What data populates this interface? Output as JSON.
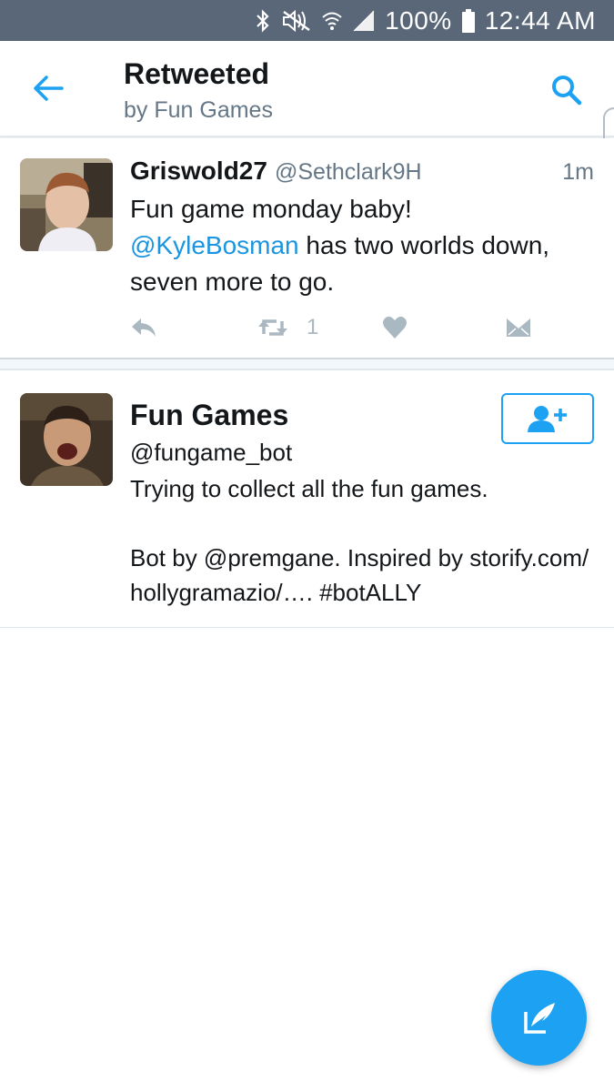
{
  "status_bar": {
    "icons": [
      "bluetooth-icon",
      "mute-icon",
      "wifi-icon",
      "signal-icon",
      "battery-icon"
    ],
    "battery": "100%",
    "time": "12:44 AM",
    "background": "#596778"
  },
  "header": {
    "title": "Retweeted",
    "subtitle": "by Fun Games",
    "back_icon": "back-arrow-icon",
    "search_icon": "search-icon",
    "accent": "#1da1f2"
  },
  "tweet": {
    "name": "Griswold27",
    "handle": "@Sethclark9H",
    "time": "1m",
    "text_line1": "Fun game monday baby!",
    "mention": "@KyleBosman",
    "text_rest": " has two worlds down, seven more to go.",
    "retweet_count": "1",
    "actions": [
      "reply-icon",
      "retweet-icon",
      "like-icon",
      "direct-message-icon"
    ]
  },
  "profile": {
    "name": "Fun Games",
    "handle": "@fungame_bot",
    "bio": "Trying to collect all the fun games.\n\nBot by @premgane. Inspired by storify.com/\nhollygramazio/…. #botALLY",
    "follow_icon": "add-user-icon"
  },
  "fab": {
    "icon": "compose-tweet-icon",
    "color": "#1da1f2"
  }
}
